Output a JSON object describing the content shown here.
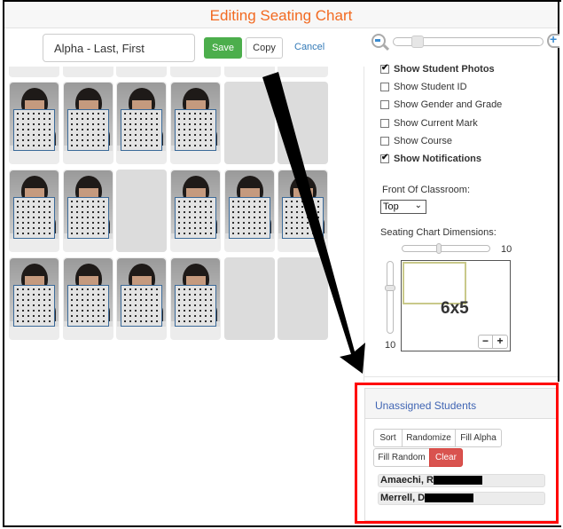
{
  "header": {
    "title": "Editing Seating Chart"
  },
  "toolbar": {
    "chart_name": "Alpha - Last, First",
    "save_label": "Save",
    "copy_label": "Copy",
    "cancel_label": "Cancel",
    "photo_zoom_percent": 15
  },
  "seating": {
    "rows": [
      [
        "photo",
        "photo",
        "photo",
        "photo",
        "empty",
        "empty"
      ],
      [
        "photo",
        "photo",
        "empty",
        "photo",
        "photo",
        "photo"
      ],
      [
        "photo",
        "photo",
        "photo",
        "photo",
        "empty",
        "empty"
      ]
    ]
  },
  "options": {
    "items": [
      {
        "label": "Show Student Photos",
        "checked": true
      },
      {
        "label": "Show Student ID",
        "checked": false
      },
      {
        "label": "Show Gender and Grade",
        "checked": false
      },
      {
        "label": "Show Current Mark",
        "checked": false
      },
      {
        "label": "Show Course",
        "checked": false
      },
      {
        "label": "Show Notifications",
        "checked": true
      }
    ],
    "front_label": "Front Of Classroom:",
    "front_value": "Top",
    "dimensions_label": "Seating Chart Dimensions:",
    "max_columns": "10",
    "max_rows": "10",
    "dimension_text": "6x5",
    "minus_label": "−",
    "plus_label": "+"
  },
  "unassigned": {
    "title": "Unassigned Students",
    "buttons": {
      "sort": "Sort",
      "randomize": "Randomize",
      "fill_alpha": "Fill Alpha",
      "fill_random": "Fill Random",
      "clear": "Clear"
    },
    "students": [
      {
        "name": "Amaechi, R"
      },
      {
        "name": "Merrell, D"
      }
    ]
  },
  "colors": {
    "title": "#f26a21",
    "save": "#4cae4c",
    "link": "#337ab7",
    "danger": "#d9534f",
    "highlight_box": "#ff0000"
  }
}
